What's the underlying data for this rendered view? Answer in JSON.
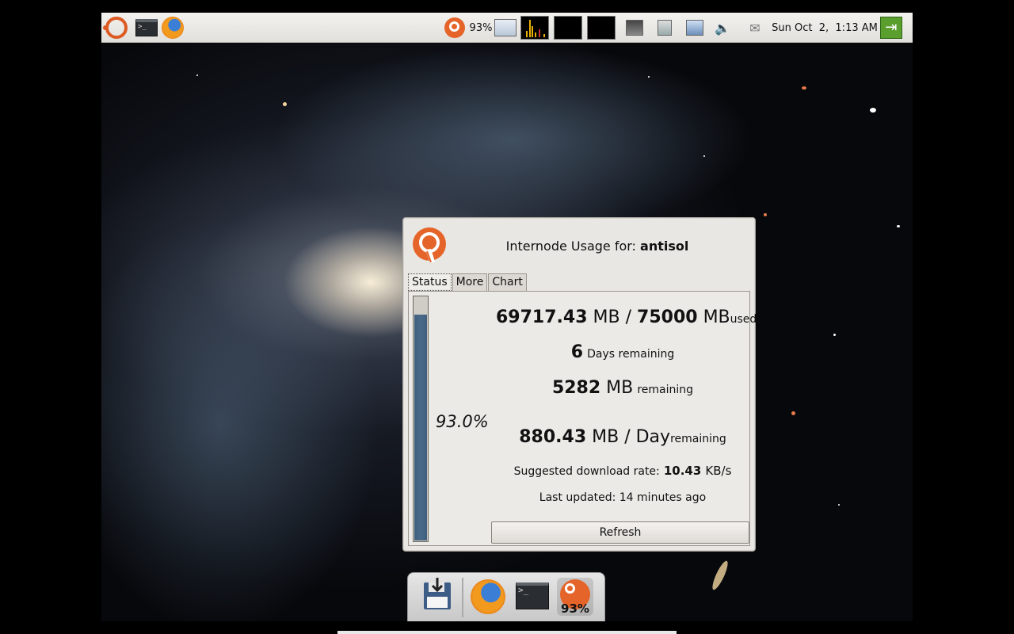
{
  "top_panel": {
    "battery_percent": "93%",
    "clock": "Sun Oct  2,  1:13 AM"
  },
  "window": {
    "title_prefix": "Internode Usage for:",
    "username": "antisol",
    "tabs": [
      "Status",
      "More",
      "Chart"
    ],
    "active_tab": "Status",
    "usage_fraction": 0.93,
    "percent_label": "93.0%",
    "used_mb": "69717.43",
    "used_unit": "MB",
    "separator": "/",
    "quota_mb": "75000",
    "quota_unit": "MB",
    "used_suffix": "used.",
    "days_value": "6",
    "days_suffix": "Days remaining",
    "remaining_mb": "5282",
    "remaining_unit": "MB",
    "remaining_suffix": "remaining",
    "per_day_value": "880.43",
    "per_day_unit": "MB / Day",
    "per_day_suffix": "remaining",
    "rate_label": "Suggested download rate:",
    "rate_value": "10.43",
    "rate_unit": "KB/s",
    "last_updated": "Last updated: 14 minutes ago",
    "refresh_label": "Refresh"
  },
  "dock": {
    "node_badge": "93%"
  },
  "colors": {
    "progress_fill": "#4a6a8a",
    "accent_orange": "#e5642a"
  }
}
